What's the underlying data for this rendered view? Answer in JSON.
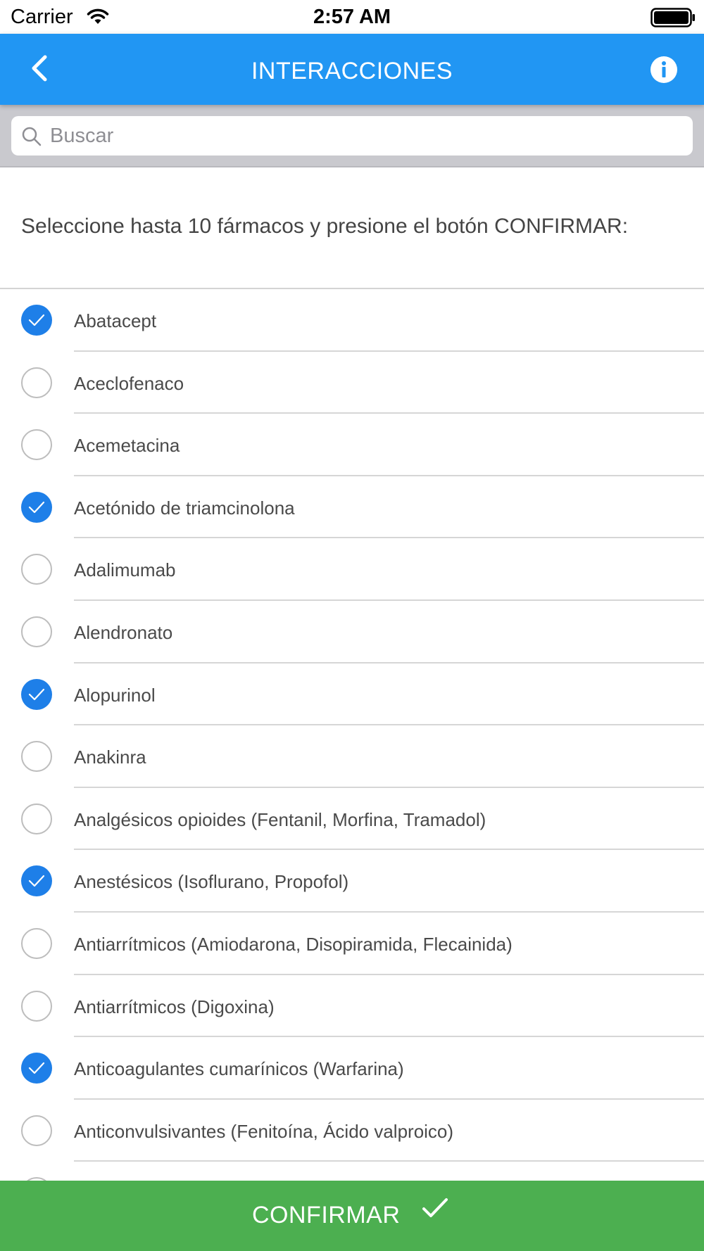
{
  "status_bar": {
    "carrier": "Carrier",
    "time": "2:57 AM"
  },
  "nav": {
    "title": "INTERACCIONES",
    "back_icon": "chevron-left-icon",
    "info_icon": "info-icon"
  },
  "search": {
    "placeholder": "Buscar",
    "value": ""
  },
  "instruction": "Seleccione hasta 10 fármacos y presione el botón CONFIRMAR:",
  "items": [
    {
      "label": "Abatacept",
      "checked": true
    },
    {
      "label": "Aceclofenaco",
      "checked": false
    },
    {
      "label": "Acemetacina",
      "checked": false
    },
    {
      "label": "Acetónido de triamcinolona",
      "checked": true
    },
    {
      "label": "Adalimumab",
      "checked": false
    },
    {
      "label": "Alendronato",
      "checked": false
    },
    {
      "label": "Alopurinol",
      "checked": true
    },
    {
      "label": "Anakinra",
      "checked": false
    },
    {
      "label": "Analgésicos opioides (Fentanil, Morfina, Tramadol)",
      "checked": false
    },
    {
      "label": "Anestésicos (Isoflurano, Propofol)",
      "checked": true
    },
    {
      "label": "Antiarrítmicos (Amiodarona, Disopiramida, Flecainida)",
      "checked": false
    },
    {
      "label": "Antiarrítmicos (Digoxina)",
      "checked": false
    },
    {
      "label": "Anticoagulantes cumarínicos (Warfarina)",
      "checked": true
    },
    {
      "label": "Anticonvulsivantes (Fenitoína, Ácido valproico)",
      "checked": false
    }
  ],
  "confirm": {
    "label": "CONFIRMAR"
  },
  "colors": {
    "nav": "#2196F3",
    "check": "#1e7fe8",
    "confirm": "#4CAF50"
  }
}
